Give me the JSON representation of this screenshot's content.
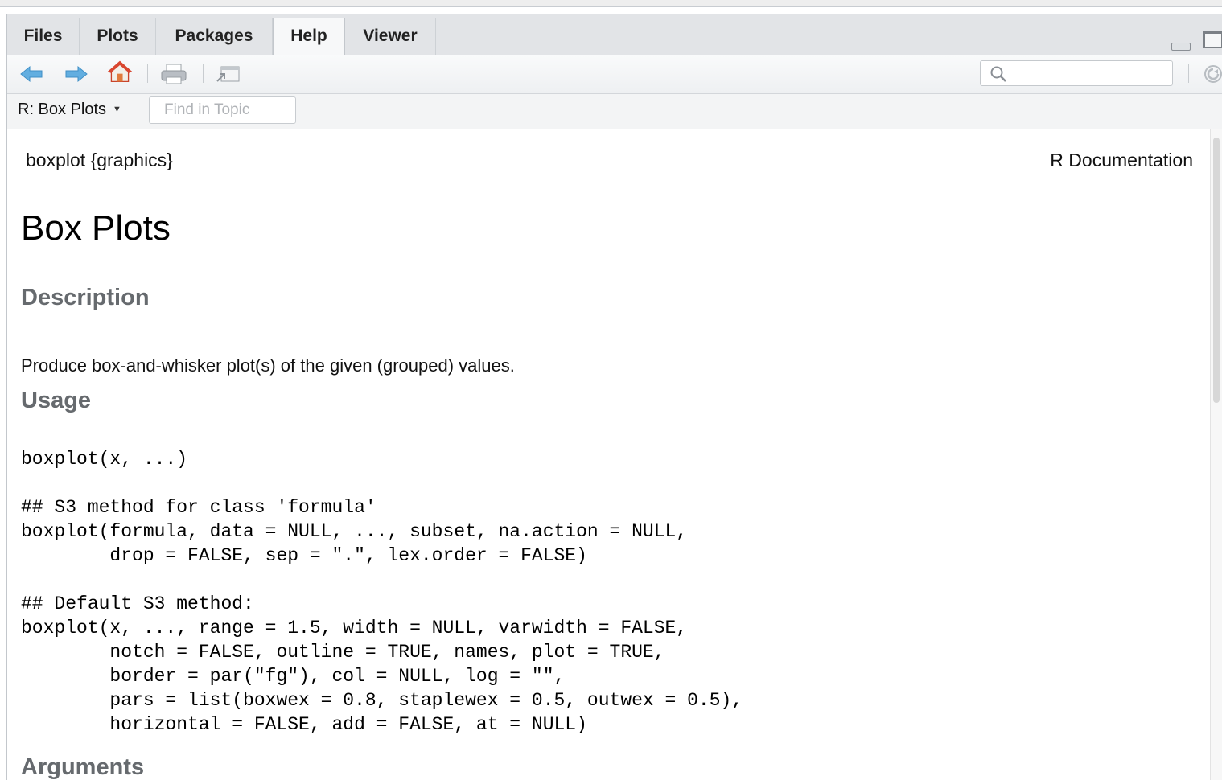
{
  "tabs": [
    {
      "label": "Files",
      "active": false
    },
    {
      "label": "Plots",
      "active": false
    },
    {
      "label": "Packages",
      "active": false
    },
    {
      "label": "Help",
      "active": true
    },
    {
      "label": "Viewer",
      "active": false
    }
  ],
  "toolbar": {
    "icons": [
      "back-arrow-icon",
      "forward-arrow-icon",
      "home-icon",
      "print-icon",
      "new-window-icon",
      "search-icon",
      "refresh-icon"
    ],
    "search_value": ""
  },
  "topic_bar": {
    "topic_label": "R: Box Plots",
    "find_placeholder": "Find in Topic"
  },
  "doc": {
    "package_line": "boxplot {graphics}",
    "r_documentation": "R Documentation",
    "title": "Box Plots",
    "description_heading": "Description",
    "description_text": "Produce box-and-whisker plot(s) of the given (grouped) values.",
    "usage_heading": "Usage",
    "usage_code_1": "boxplot(x, ...)",
    "usage_code_2": "## S3 method for class 'formula'\nboxplot(formula, data = NULL, ..., subset, na.action = NULL,\n        drop = FALSE, sep = \".\", lex.order = FALSE)",
    "usage_code_3": "## Default S3 method:\nboxplot(x, ..., range = 1.5, width = NULL, varwidth = FALSE,\n        notch = FALSE, outline = TRUE, names, plot = TRUE,\n        border = par(\"fg\"), col = NULL, log = \"\",\n        pars = list(boxwex = 0.8, staplewex = 0.5, outwex = 0.5),\n        horizontal = FALSE, add = FALSE, at = NULL)",
    "arguments_heading": "Arguments"
  },
  "colors": {
    "arrow_blue": "#5aa8dc",
    "home_red": "#d9462f",
    "heading_gray": "#666a6e"
  }
}
